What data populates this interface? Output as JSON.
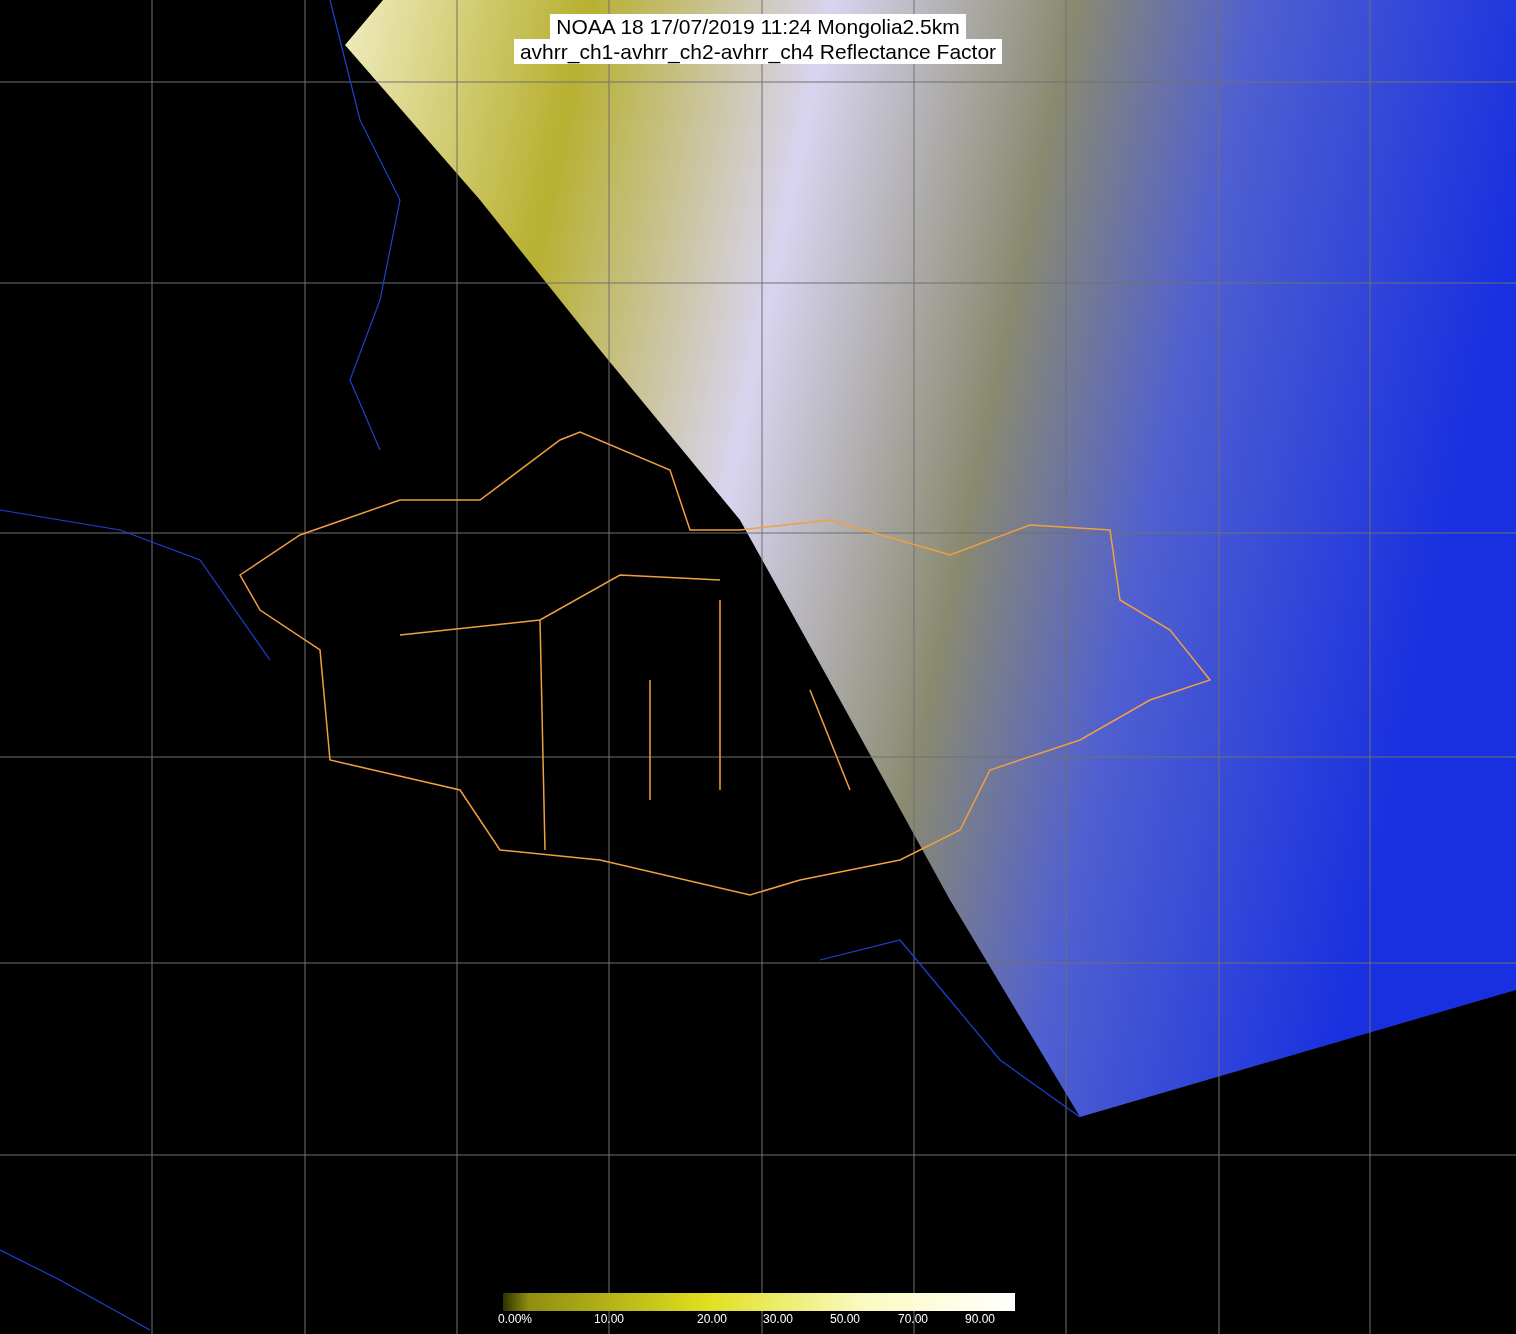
{
  "title": {
    "lines": [
      "NOAA 18 17/07/2019 11:24 Mongolia2.5km",
      "avhrr_ch1-avhrr_ch2-avhrr_ch4 Reflectance Factor"
    ]
  },
  "colorbar": {
    "labels": [
      "0.00%",
      "10.00",
      "20.00",
      "30.00",
      "50.00",
      "70.00",
      "90.00"
    ]
  }
}
